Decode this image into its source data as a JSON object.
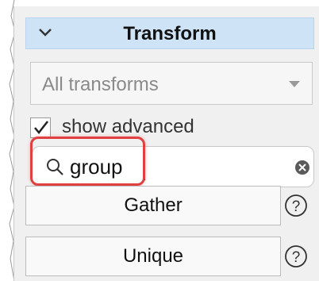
{
  "panel": {
    "header": {
      "title": "Transform",
      "collapse_icon": "chevron-down-icon"
    },
    "transform_filter": {
      "selected": "All transforms"
    },
    "show_advanced": {
      "label": "show advanced",
      "checked": true
    },
    "search": {
      "value": "group",
      "clear_icon": "clear-circle-x-icon",
      "search_icon": "magnifier-icon"
    },
    "results": [
      {
        "label": "Gather",
        "help_icon": "question-circle-icon"
      },
      {
        "label": "Unique",
        "help_icon": "question-circle-icon"
      }
    ]
  },
  "colors": {
    "header_bg": "#cfe3f7",
    "highlight_border": "#e0403f",
    "panel_bg": "#f0f0f0"
  }
}
